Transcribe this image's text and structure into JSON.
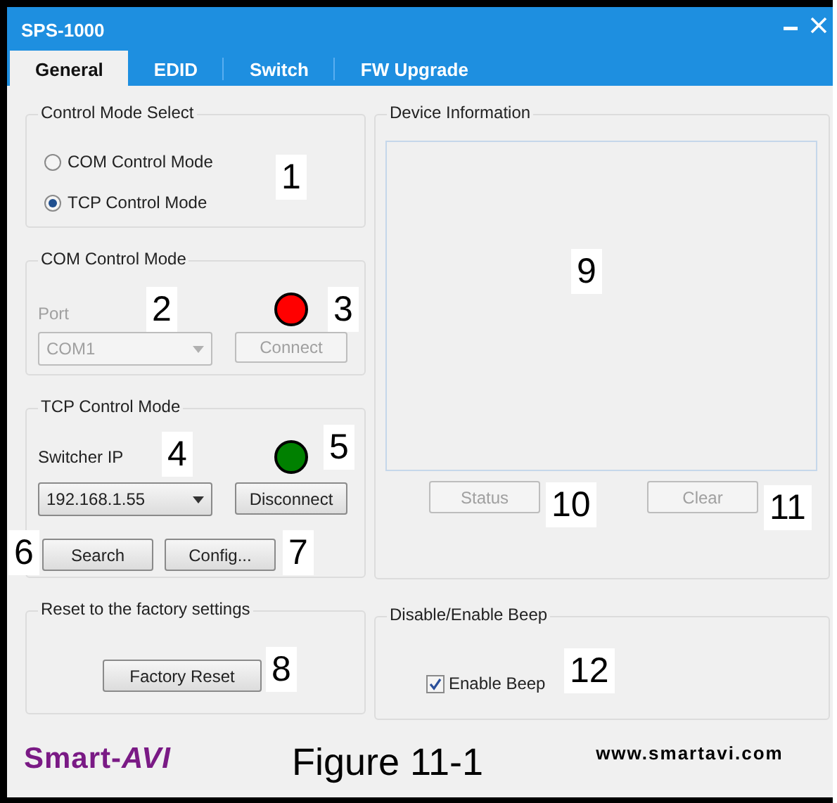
{
  "window": {
    "title": "SPS-1000"
  },
  "tabs": [
    {
      "label": "General",
      "selected": true
    },
    {
      "label": "EDID",
      "selected": false
    },
    {
      "label": "Switch",
      "selected": false
    },
    {
      "label": "FW Upgrade",
      "selected": false
    }
  ],
  "control_mode": {
    "title": "Control Mode Select",
    "callout": "1",
    "options": [
      {
        "label": "COM Control Mode",
        "selected": false
      },
      {
        "label": "TCP Control Mode",
        "selected": true
      }
    ]
  },
  "com": {
    "title": "COM Control Mode",
    "disabled": true,
    "port_label": "Port",
    "port_value": "COM1",
    "port_callout": "2",
    "color": "#ff0000",
    "button": "Connect",
    "button_callout": "3"
  },
  "tcp": {
    "title": "TCP Control Mode",
    "disabled": false,
    "ip_label": "Switcher IP",
    "ip_callout": "4",
    "color": "#008000",
    "indicator_callout": "5",
    "ip_value": "192.168.1.55",
    "button": "Disconnect",
    "search": "Search",
    "search_callout": "6",
    "config": "Config...",
    "config_callout": "7"
  },
  "device_info": {
    "title": "Device Information",
    "callout": "9",
    "buttons": [
      {
        "label": "Status",
        "disabled": true,
        "callout": "10"
      },
      {
        "label": "Clear",
        "disabled": true,
        "callout": "11"
      }
    ]
  },
  "reset": {
    "title": "Reset to the factory settings",
    "button": "Factory Reset",
    "callout": "8"
  },
  "beep": {
    "title": "Disable/Enable Beep",
    "label": "Enable Beep",
    "checked": true,
    "callout": "12"
  },
  "footer": {
    "logo": "Smart-**AVI**",
    "caption": "Figure 11-1",
    "url": "www.smartavi.com"
  }
}
